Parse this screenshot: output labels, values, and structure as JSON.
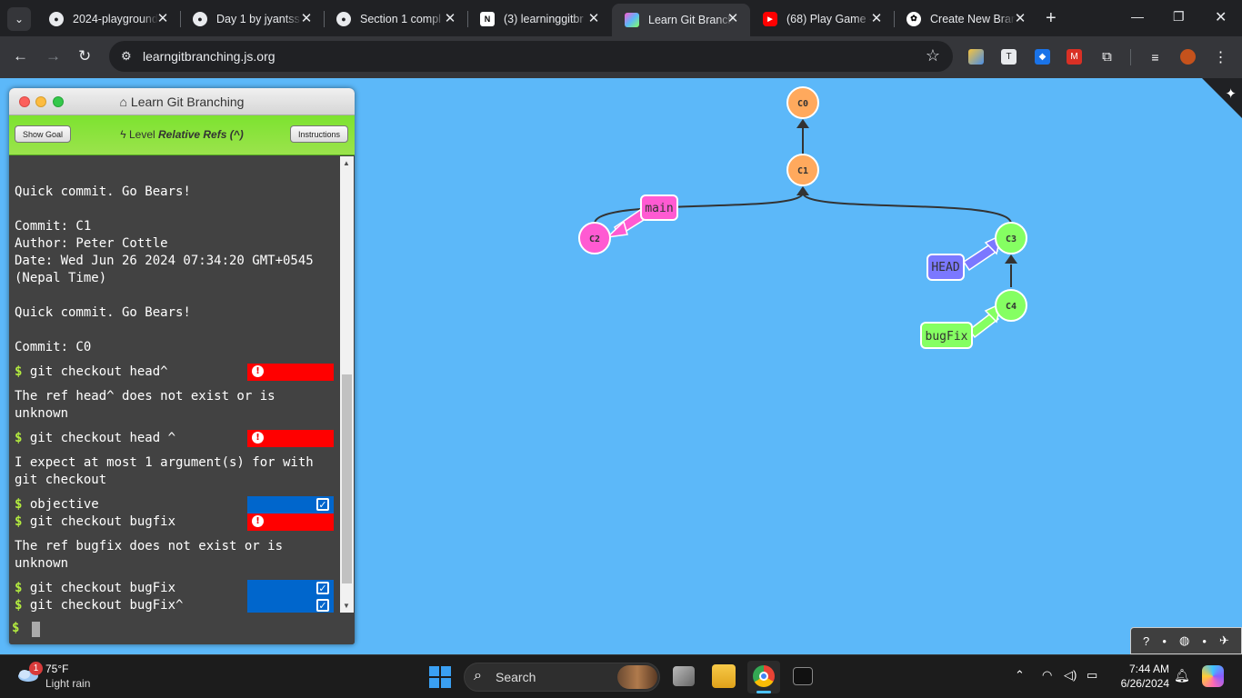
{
  "browser": {
    "tabs": [
      {
        "title": "2024-playground",
        "icon": "github-icon"
      },
      {
        "title": "Day 1 by jyantss",
        "icon": "github-icon"
      },
      {
        "title": "Section 1 compl",
        "icon": "github-icon"
      },
      {
        "title": "(3) learninggitbr",
        "icon": "notion-icon"
      },
      {
        "title": "Learn Git Branch",
        "icon": "lgb-icon",
        "active": true
      },
      {
        "title": "(68) Play Game -",
        "icon": "youtube-icon"
      },
      {
        "title": "Create New Bran",
        "icon": "openai-icon"
      }
    ],
    "url": "learngitbranching.js.org"
  },
  "terminal": {
    "title": "Learn Git Branching",
    "show_goal": "Show Goal",
    "instructions": "Instructions",
    "level_prefix": "Level",
    "level_name": "Relative Refs (^)",
    "lines": [
      "Quick commit. Go Bears!",
      "Commit: C1",
      "Author: Peter Cottle",
      "Date: Wed Jun 26 2024 07:34:20 GMT+0545",
      "(Nepal Time)",
      "Quick commit. Go Bears!",
      "Commit: C0",
      "git checkout head^",
      "The ref head^ does not exist or is",
      "unknown",
      "git checkout head ^",
      "I expect at most 1 argument(s) for with",
      "git checkout",
      "objective",
      "git checkout bugfix",
      "The ref bugfix does not exist or is",
      "unknown",
      "git checkout bugFix",
      "git checkout bugFix^"
    ],
    "prompt": "$"
  },
  "graph": {
    "commits": [
      "C0",
      "C1",
      "C2",
      "C3",
      "C4"
    ],
    "branches": [
      "main",
      "HEAD",
      "bugFix"
    ],
    "colors": {
      "main": "#ff5ad2",
      "c0": "#ffa95d",
      "bugfix": "#85ff62",
      "head": "#7b78ff",
      "background": "#5cb8f9"
    }
  },
  "helpbar": {
    "icons": [
      "help-icon",
      "globe-icon",
      "twitter-icon"
    ]
  },
  "taskbar": {
    "weather_temp": "75°F",
    "weather_cond": "Light rain",
    "weather_badge": "1",
    "search_placeholder": "Search",
    "time": "7:44 AM",
    "date": "6/26/2024"
  }
}
